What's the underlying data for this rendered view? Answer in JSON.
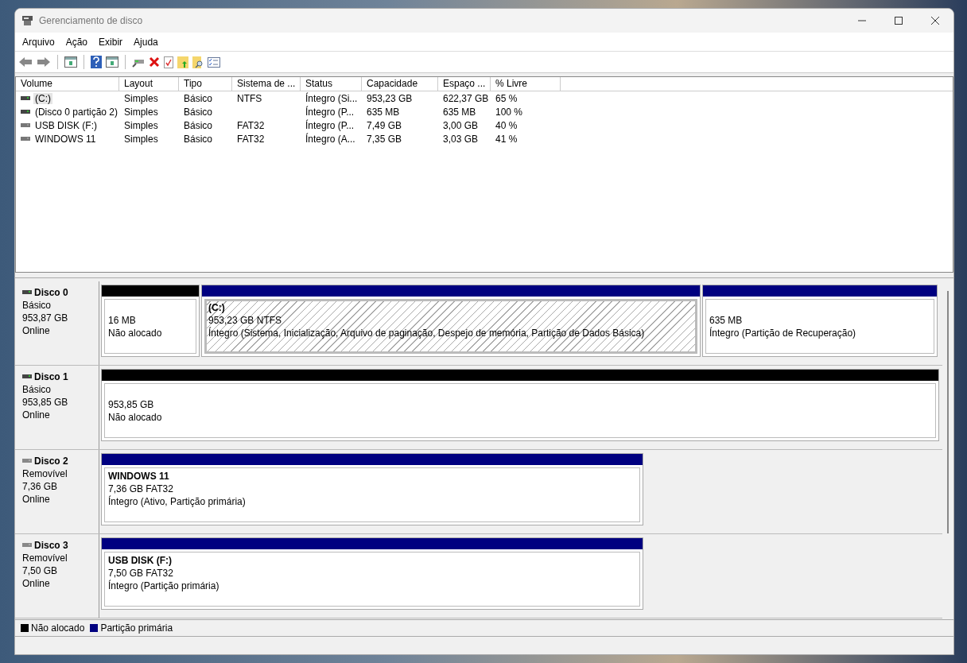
{
  "window": {
    "title": "Gerenciamento de disco"
  },
  "menu": [
    "Arquivo",
    "Ação",
    "Exibir",
    "Ajuda"
  ],
  "table": {
    "columns": [
      "Volume",
      "Layout",
      "Tipo",
      "Sistema de ...",
      "Status",
      "Capacidade",
      "Espaço ...",
      "% Livre"
    ],
    "rows": [
      {
        "selected": true,
        "cells": [
          "(C:)",
          "Simples",
          "Básico",
          "NTFS",
          "Íntegro (Si...",
          "953,23 GB",
          "622,37 GB",
          "65 %"
        ]
      },
      {
        "selected": false,
        "cells": [
          "(Disco 0 partição 2)",
          "Simples",
          "Básico",
          "",
          "Íntegro (P...",
          "635 MB",
          "635 MB",
          "100 %"
        ]
      },
      {
        "selected": false,
        "cells": [
          "USB DISK (F:)",
          "Simples",
          "Básico",
          "FAT32",
          "Íntegro (P...",
          "7,49 GB",
          "3,00 GB",
          "40 %"
        ]
      },
      {
        "selected": false,
        "cells": [
          "WINDOWS 11",
          "Simples",
          "Básico",
          "FAT32",
          "Íntegro (A...",
          "7,35 GB",
          "3,03 GB",
          "41 %"
        ]
      }
    ]
  },
  "disks": [
    {
      "name": "Disco 0",
      "type": "Básico",
      "size": "953,87 GB",
      "status": "Online",
      "partitions": [
        {
          "kind": "unallocated",
          "selected": false,
          "lines": [
            "16 MB",
            "Não alocado"
          ]
        },
        {
          "kind": "primary",
          "selected": true,
          "title": "(C:)",
          "lines": [
            "953,23 GB NTFS",
            "Íntegro (Sistema, Inicialização, Arquivo de paginação, Despejo de memória, Partição de Dados Básica)"
          ]
        },
        {
          "kind": "primary",
          "selected": false,
          "lines": [
            "635 MB",
            "Íntegro (Partição de Recuperação)"
          ]
        }
      ]
    },
    {
      "name": "Disco 1",
      "type": "Básico",
      "size": "953,85 GB",
      "status": "Online",
      "partitions": [
        {
          "kind": "unallocated",
          "selected": false,
          "lines": [
            "953,85 GB",
            "Não alocado"
          ]
        }
      ]
    },
    {
      "name": "Disco 2",
      "type": "Removível",
      "size": "7,36 GB",
      "status": "Online",
      "partitions": [
        {
          "kind": "primary",
          "selected": false,
          "title": "WINDOWS 11",
          "lines": [
            "7,36 GB FAT32",
            "Íntegro (Ativo, Partição primária)"
          ]
        }
      ]
    },
    {
      "name": "Disco 3",
      "type": "Removível",
      "size": "7,50 GB",
      "status": "Online",
      "partitions": [
        {
          "kind": "primary",
          "selected": false,
          "title": "USB DISK  (F:)",
          "lines": [
            "7,50 GB FAT32",
            "Íntegro (Partição primária)"
          ]
        }
      ]
    }
  ],
  "legend": [
    {
      "label": "Não alocado",
      "color": "#000000"
    },
    {
      "label": "Partição primária",
      "color": "#000080"
    }
  ]
}
